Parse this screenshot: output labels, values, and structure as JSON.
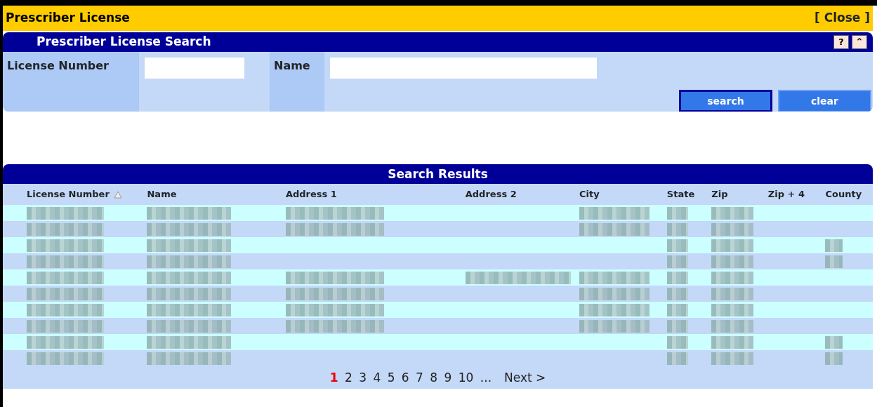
{
  "window": {
    "title": "Prescriber License",
    "close": "[ Close ]"
  },
  "search_panel": {
    "title": "Prescriber License Search",
    "help": "?",
    "collapse": "⌃",
    "fields": [
      {
        "label": "License Number"
      },
      {
        "label": "Name"
      }
    ],
    "buttons": [
      {
        "label": "search",
        "kind": "primary"
      },
      {
        "label": "clear",
        "kind": "secondary"
      }
    ]
  },
  "results": {
    "title": "Search Results",
    "columns": [
      {
        "label": "License Number",
        "sorted": true
      },
      {
        "label": "Name",
        "sorted": false
      },
      {
        "label": "Address 1",
        "sorted": false
      },
      {
        "label": "Address 2",
        "sorted": false
      },
      {
        "label": "City",
        "sorted": false
      },
      {
        "label": "State",
        "sorted": false
      },
      {
        "label": "Zip",
        "sorted": false
      },
      {
        "label": "Zip + 4",
        "sorted": false
      },
      {
        "label": "County",
        "sorted": false
      }
    ],
    "rows": [
      {
        "filled": [
          true,
          true,
          true,
          false,
          true,
          true,
          true,
          false,
          false
        ]
      },
      {
        "filled": [
          true,
          true,
          true,
          false,
          true,
          true,
          true,
          false,
          false
        ]
      },
      {
        "filled": [
          true,
          true,
          false,
          false,
          false,
          true,
          true,
          false,
          true
        ]
      },
      {
        "filled": [
          true,
          true,
          false,
          false,
          false,
          true,
          true,
          false,
          true
        ]
      },
      {
        "filled": [
          true,
          true,
          true,
          true,
          true,
          true,
          true,
          false,
          false
        ]
      },
      {
        "filled": [
          true,
          true,
          true,
          false,
          true,
          true,
          true,
          false,
          false
        ]
      },
      {
        "filled": [
          true,
          true,
          true,
          false,
          true,
          true,
          true,
          false,
          false
        ]
      },
      {
        "filled": [
          true,
          true,
          true,
          false,
          true,
          true,
          true,
          false,
          false
        ]
      },
      {
        "filled": [
          true,
          true,
          false,
          false,
          false,
          true,
          true,
          false,
          true
        ]
      },
      {
        "filled": [
          true,
          true,
          false,
          false,
          false,
          true,
          true,
          false,
          true
        ]
      }
    ],
    "pages": [
      {
        "label": "1",
        "selected": true
      },
      {
        "label": "2",
        "selected": false
      },
      {
        "label": "3",
        "selected": false
      },
      {
        "label": "4",
        "selected": false
      },
      {
        "label": "5",
        "selected": false
      },
      {
        "label": "6",
        "selected": false
      },
      {
        "label": "7",
        "selected": false
      },
      {
        "label": "8",
        "selected": false
      },
      {
        "label": "9",
        "selected": false
      },
      {
        "label": "10",
        "selected": false
      }
    ],
    "ellipsis": "...",
    "next": "Next >"
  }
}
